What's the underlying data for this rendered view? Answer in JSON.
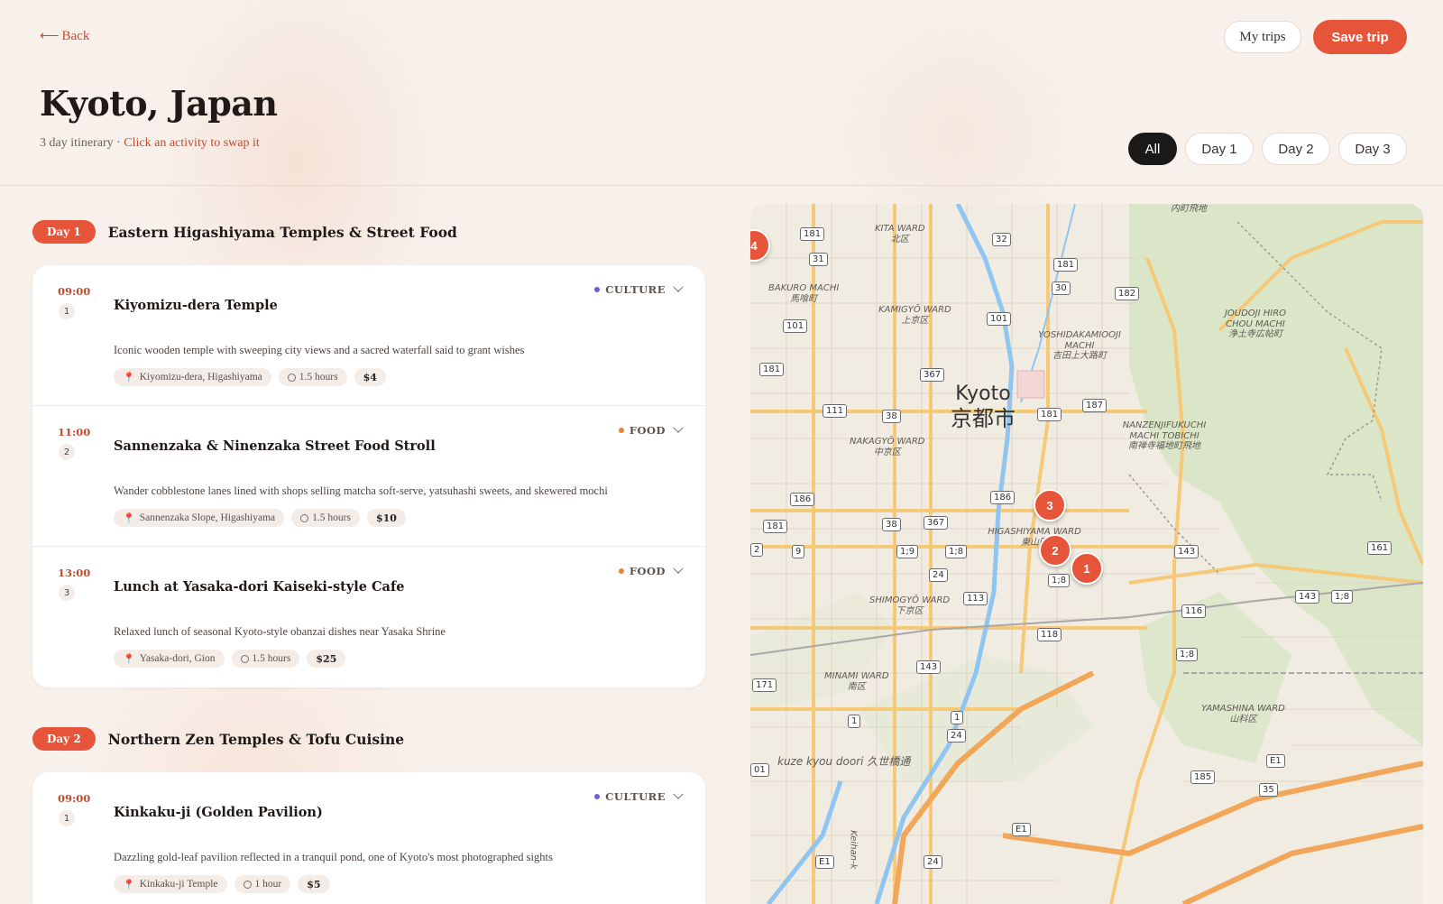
{
  "nav": {
    "back_label": "Back",
    "my_trips_label": "My trips",
    "save_trip_label": "Save trip"
  },
  "header": {
    "title": "Kyoto, Japan",
    "subtitle_prefix": "3 day itinerary · ",
    "subtitle_hint": "Click an activity to swap it"
  },
  "filters": [
    "All",
    "Day 1",
    "Day 2",
    "Day 3"
  ],
  "active_filter": "All",
  "days": [
    {
      "pill": "Day 1",
      "title": "Eastern Higashiyama Temples & Street Food",
      "activities": [
        {
          "time": "09:00",
          "num": "1",
          "title": "Kiyomizu-dera Temple",
          "category": "CULTURE",
          "category_color": "#6b5fd8",
          "description": "Iconic wooden temple with sweeping city views and a sacred waterfall said to grant wishes",
          "location": "Kiyomizu-dera, Higashiyama",
          "duration": "1.5 hours",
          "cost": "$4"
        },
        {
          "time": "11:00",
          "num": "2",
          "title": "Sannenzaka & Ninenzaka Street Food Stroll",
          "category": "FOOD",
          "category_color": "#e8862d",
          "description": "Wander cobblestone lanes lined with shops selling matcha soft-serve, yatsuhashi sweets, and skewered mochi",
          "location": "Sannenzaka Slope, Higashiyama",
          "duration": "1.5 hours",
          "cost": "$10"
        },
        {
          "time": "13:00",
          "num": "3",
          "title": "Lunch at Yasaka-dori Kaiseki-style Cafe",
          "category": "FOOD",
          "category_color": "#e8862d",
          "description": "Relaxed lunch of seasonal Kyoto-style obanzai dishes near Yasaka Shrine",
          "location": "Yasaka-dori, Gion",
          "duration": "1.5 hours",
          "cost": "$25"
        }
      ]
    },
    {
      "pill": "Day 2",
      "title": "Northern Zen Temples & Tofu Cuisine",
      "activities": [
        {
          "time": "09:00",
          "num": "1",
          "title": "Kinkaku-ji (Golden Pavilion)",
          "category": "CULTURE",
          "category_color": "#6b5fd8",
          "description": "Dazzling gold-leaf pavilion reflected in a tranquil pond, one of Kyoto's most photographed sights",
          "location": "Kinkaku-ji Temple",
          "duration": "1 hour",
          "cost": "$5"
        }
      ]
    }
  ],
  "map": {
    "city_en": "Kyoto",
    "city_ja": "京都市",
    "markers": [
      "1",
      "2",
      "3",
      "4"
    ],
    "marker_color": "#e6553a",
    "wards": [
      {
        "en": "KITA WARD",
        "ja": "北区"
      },
      {
        "en": "BAKURO MACHI",
        "ja": "馬喰町"
      },
      {
        "en": "KAMIGYŌ WARD",
        "ja": "上京区"
      },
      {
        "en": "YOSHIDAKAMIOOJI MACHI",
        "ja": "吉田上大路町"
      },
      {
        "en": "JOUDOJI HIRO CHOU MACHI",
        "ja": "浄土寺広帖町"
      },
      {
        "en": "NAKAGYŌ WARD",
        "ja": "中京区"
      },
      {
        "en": "NANZENJIFUKUCHI MACHI TOBICHI",
        "ja": "南禅寺福地町飛地"
      },
      {
        "en": "HIGASHIYAMA WARD",
        "ja": "東山区"
      },
      {
        "en": "SHIMOGYŌ WARD",
        "ja": "下京区"
      },
      {
        "en": "MINAMI WARD",
        "ja": "南区"
      },
      {
        "en": "YAMASHINA WARD",
        "ja": "山科区"
      },
      {
        "en": "",
        "ja": "内町飛地"
      },
      {
        "en": "kuze kyou doori",
        "ja": "久世橋通"
      },
      {
        "en": "Keihan-k",
        "ja": ""
      }
    ],
    "shields": [
      "181",
      "31",
      "32",
      "181",
      "30",
      "182",
      "101",
      "101",
      "367",
      "181",
      "187",
      "111",
      "38",
      "181",
      "186",
      "186",
      "38",
      "367",
      "181",
      "9",
      "1;9",
      "1;8",
      "24",
      "143",
      "161",
      "1;8",
      "113",
      "116",
      "143",
      "1;8",
      "118",
      "1;8",
      "143",
      "171",
      "1",
      "1",
      "24",
      "E1",
      "185",
      "35",
      "E1",
      "E1",
      "24",
      "01",
      "2"
    ]
  }
}
